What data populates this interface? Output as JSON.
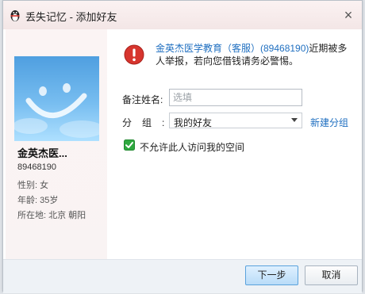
{
  "window": {
    "title": "丢失记忆 - 添加好友",
    "close_label": "×"
  },
  "profile": {
    "nickname": "金英杰医...",
    "qq": "89468190",
    "gender": "性别: 女",
    "age": "年龄: 35岁",
    "location": "所在地: 北京  朝阳"
  },
  "warning": {
    "link": "金英杰医学教育（客服）(89468190)",
    "text": "近期被多人举报，若向您借钱请务必警惕。"
  },
  "form": {
    "remark_label": "备注姓名:",
    "remark_placeholder": "选填",
    "remark_value": "",
    "group_label": "分组:",
    "group_value": "我的好友",
    "new_group_link": "新建分组",
    "checkbox_label": "不允许此人访问我的空间",
    "checkbox_checked": true
  },
  "buttons": {
    "next": "下一步",
    "cancel": "取消"
  },
  "colors": {
    "link": "#1f6fc0",
    "warning_icon": "#d7352e",
    "checkbox": "#2ea83f"
  }
}
